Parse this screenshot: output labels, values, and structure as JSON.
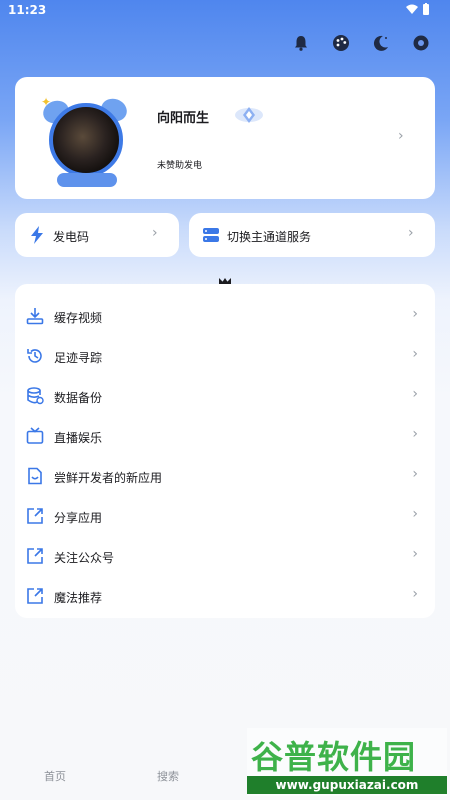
{
  "status_bar": {
    "time": "11:23"
  },
  "profile": {
    "name": "向阳而生",
    "subtitle": "未赞助发电"
  },
  "quick_actions": [
    {
      "label": "发电码",
      "icon": "lightning-icon"
    },
    {
      "label": "切换主通道服务",
      "icon": "server-icon"
    }
  ],
  "menu": {
    "items": [
      {
        "label": "缓存视频",
        "icon": "download-icon"
      },
      {
        "label": "足迹寻踪",
        "icon": "history-icon"
      },
      {
        "label": "数据备份",
        "icon": "database-icon"
      },
      {
        "label": "直播娱乐",
        "icon": "tv-icon"
      },
      {
        "label": "尝鲜开发者的新应用",
        "icon": "new-app-icon"
      },
      {
        "label": "分享应用",
        "icon": "share-icon"
      },
      {
        "label": "关注公众号",
        "icon": "share-icon"
      },
      {
        "label": "魔法推荐",
        "icon": "share-icon"
      }
    ]
  },
  "tabbar": {
    "tabs": [
      {
        "label": "首页"
      },
      {
        "label": "搜索"
      }
    ]
  },
  "watermark": {
    "top": "谷普软件园",
    "bottom": "www.gupuxiazai.com"
  },
  "colors": {
    "accent": "#3b78e7",
    "background_top": "#4f86ee"
  }
}
